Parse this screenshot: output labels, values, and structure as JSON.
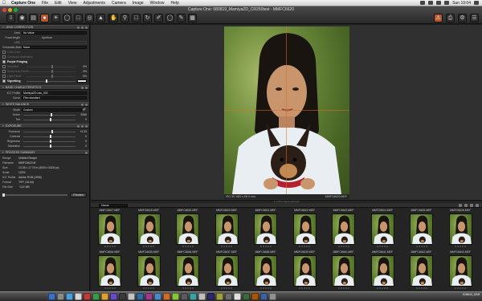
{
  "menubar": {
    "apple": "",
    "items": [
      "Capture One",
      "File",
      "Edit",
      "View",
      "Adjustments",
      "Camera",
      "Image",
      "Window",
      "Help"
    ],
    "clock": "Sun 19:04",
    "battery": "(Charged)"
  },
  "window": {
    "title": "Capture One: 080819_MamiyaZD_CR250test - MMFC6620"
  },
  "lens_correction": {
    "header": "LENS CORRECTION",
    "lens_label": "Lens",
    "lens_value": "No Value",
    "focal_length_label": "Focal length",
    "aperture_label": "Aperture",
    "lcc_label": "LCC",
    "chromatic_label": "Chromatic Aberration",
    "chromatic_value": "None",
    "color_cast_label": "Color Cast",
    "chromatic_aberration_label": "Chromatic Aberration",
    "purple_fringing_label": "Purple Fringing",
    "distortion_label": "Distortion",
    "sharpness_label": "Sharpness Falloff",
    "light_falloff_label": "Light Falloff",
    "vignetting_label": "Vignetting",
    "zero": "0%"
  },
  "base_characteristics": {
    "header": "BASE CHARACTERISTICS",
    "icc_label": "ICC Profile",
    "icc_value": "MamiyaZD-raw_002",
    "curve_label": "Curve",
    "curve_value": "Film standard"
  },
  "white_balance": {
    "header": "WHITE BALANCE",
    "mode_label": "Mode",
    "mode_value": "Custom",
    "kelvin_label": "Kelvin",
    "kelvin_value": "5286",
    "tint_label": "Tint",
    "tint_value": "0"
  },
  "exposure": {
    "header": "EXPOSURE",
    "exposure_label": "Exposure",
    "exposure_value": "+0.33",
    "contrast_label": "Contrast",
    "contrast_value": "0",
    "brightness_label": "Brightness",
    "brightness_value": "0",
    "saturation_label": "Saturation",
    "saturation_value": "0"
  },
  "process_summary": {
    "header": "PROCESS SUMMARY",
    "rows": [
      {
        "label": "Recipe",
        "value": "Untitled Recipe"
      },
      {
        "label": "Filename",
        "value": "MMFC6620.tif"
      },
      {
        "label": "Size",
        "value": "13.35 x 17.76 in (4000 x 5328 px)"
      },
      {
        "label": "Scale",
        "value": "100%"
      },
      {
        "label": "ICC Profile",
        "value": "Adobe RGB (1998)"
      },
      {
        "label": "Format",
        "value": "TIFF (16-bit)"
      },
      {
        "label": "File Size",
        "value": "~122 MB"
      }
    ],
    "preview_button": "Preview"
  },
  "viewer": {
    "info_left": "ISO 50   1/60 s   f/8   0 mm",
    "filename": "MMFC6620.MEF"
  },
  "browser": {
    "counter": "1 of 65 images selected",
    "sort_label": "Name",
    "thumbs_row1": [
      "MMFC6617.MEF",
      "MMFC6618.MEF",
      "MMFC6619.MEF",
      "MMFC6620.MEF",
      "MMFC6621.MEF",
      "MMFC6622.MEF",
      "MMFC6623.MEF",
      "MMFC6624.MEF",
      "MMFC6625.MEF",
      "MMFC6626.MEF"
    ],
    "thumbs_row2": [
      "MMFC6634.MEF",
      "MMFC6635.MEF",
      "MMFC6636.MEF",
      "MMFC6637.MEF",
      "MMFC6638.MEF",
      "MMFC6639.MEF",
      "MMFC6640.MEF",
      "MMFC6641.MEF",
      "MMFC6642.MEF",
      "MMFC6643.MEF"
    ]
  },
  "dock": {
    "info_line1": "015610_024f",
    "info_line2": ""
  },
  "colors": {
    "accent": "#b4572a",
    "panel": "#2a2a2a",
    "viewer_bg": "#303030",
    "grid_overlay": "#dc6e28"
  },
  "icons": {
    "toolbar_left": [
      "import-icon",
      "capture-icon",
      "library-icon",
      "color-icon",
      "exposure-icon",
      "lens-icon",
      "crop-icon",
      "focus-icon",
      "details-icon",
      "adjust-icon",
      "metadata-icon",
      "output-icon",
      "batch-icon"
    ],
    "toolbar_center": [
      "pan-icon",
      "zoom-icon",
      "crop-tool-icon",
      "rotate-icon",
      "wb-picker-icon",
      "spot-icon",
      "annotation-icon",
      "grid-icon"
    ],
    "toolbar_right": [
      "exposure-warning-icon",
      "print-icon",
      "process-icon",
      "settings-icon"
    ]
  }
}
